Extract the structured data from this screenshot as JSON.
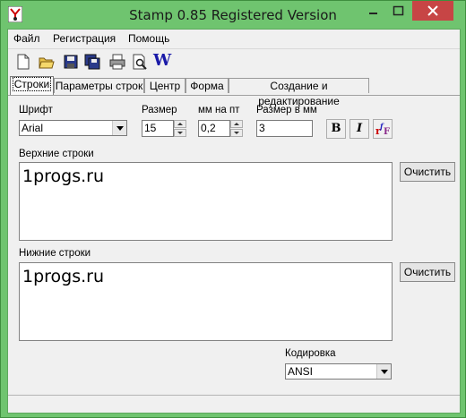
{
  "window": {
    "title": "Stamp 0.85 Registered Version"
  },
  "menu": {
    "items": [
      "Файл",
      "Регистрация",
      "Помощь"
    ]
  },
  "toolbar": {
    "tools": [
      "new-icon",
      "open-icon",
      "save-icon",
      "save-as-icon",
      "print-icon",
      "print-preview-icon",
      "w-icon"
    ],
    "w_label": "W"
  },
  "tabs": [
    "Строки",
    "Параметры строк",
    "Центр",
    "Форма",
    "Создание и редактирование"
  ],
  "active_tab": "Строки",
  "font": {
    "label": "Шрифт",
    "value": "Arial"
  },
  "size": {
    "label": "Размер",
    "value": "15"
  },
  "mm_per_pt": {
    "label": "мм на пт",
    "value": "0,2"
  },
  "size_mm": {
    "label": "Размер в мм",
    "value": "3"
  },
  "format_buttons": {
    "bold": "B",
    "italic": "I"
  },
  "upper": {
    "label": "Верхние строки",
    "text": "1progs.ru",
    "clear_label": "Очистить"
  },
  "lower": {
    "label": "Нижние строки",
    "text": "1progs.ru",
    "clear_label": "Очистить"
  },
  "encoding": {
    "label": "Кодировка",
    "value": "ANSI"
  }
}
